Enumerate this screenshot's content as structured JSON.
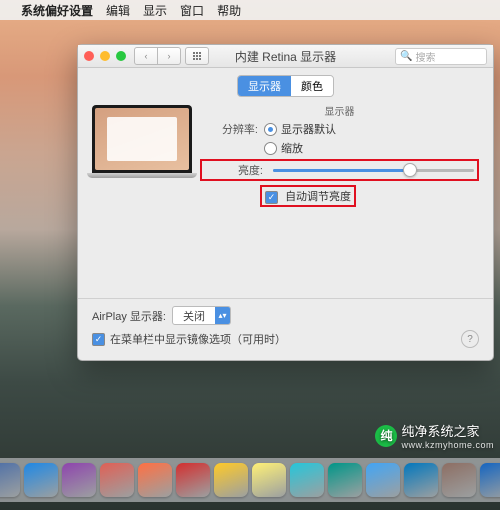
{
  "menubar": {
    "apple": "",
    "app": "系统偏好设置",
    "items": [
      "编辑",
      "显示",
      "窗口",
      "帮助"
    ]
  },
  "window": {
    "title": "内建 Retina 显示器",
    "search_placeholder": "搜索",
    "tabs": {
      "display": "显示器",
      "color": "颜色"
    },
    "section_label": "显示器",
    "resolution_label": "分辨率:",
    "res_default": "显示器默认",
    "res_scaled": "缩放",
    "brightness_label": "亮度:",
    "auto_brightness": "自动调节亮度",
    "airplay_label": "AirPlay 显示器:",
    "airplay_value": "关闭",
    "mirror_checkbox": "在菜单栏中显示镜像选项（可用时）",
    "help": "?"
  },
  "watermark": {
    "brand": "纯净系统之家",
    "url": "www.kzmyhome.com"
  },
  "dock_colors": [
    "#3fa9f5",
    "#4a6da7",
    "#1e88e5",
    "#8e44ad",
    "#e06055",
    "#ff7043",
    "#d32f2f",
    "#ffca28",
    "#fff176",
    "#26c6da",
    "#009688",
    "#42a5f5",
    "#0277bd",
    "#8d6e63",
    "#1565c0",
    "#78909c"
  ]
}
